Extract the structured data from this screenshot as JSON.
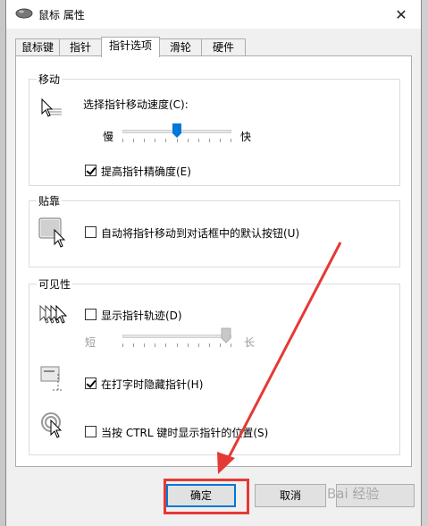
{
  "window": {
    "title": "鼠标 属性",
    "close_glyph": "✕"
  },
  "tabs": [
    {
      "label": "鼠标键",
      "active": false
    },
    {
      "label": "指针",
      "active": false
    },
    {
      "label": "指针选项",
      "active": true
    },
    {
      "label": "滑轮",
      "active": false
    },
    {
      "label": "硬件",
      "active": false
    }
  ],
  "motion": {
    "title": "移动",
    "speed_label": "选择指针移动速度(C):",
    "slow_label": "慢",
    "fast_label": "快",
    "speed_level": 0.5,
    "precision_label": "提高指针精确度(E)",
    "precision_checked": true
  },
  "snap": {
    "title": "贴靠",
    "snap_label": "自动将指针移动到对话框中的默认按钮(U)",
    "snap_checked": false
  },
  "visibility": {
    "title": "可见性",
    "trails_label": "显示指针轨迹(D)",
    "trails_checked": false,
    "short_label": "短",
    "long_label": "长",
    "trails_level": 1.0,
    "hide_label": "在打字时隐藏指针(H)",
    "hide_checked": true,
    "ctrl_label": "当按 CTRL 键时显示指针的位置(S)",
    "ctrl_checked": false
  },
  "buttons": {
    "ok": "确定",
    "cancel": "取消"
  },
  "watermark": "Bai 经验",
  "colors": {
    "accent": "#0078d7",
    "annotation": "#e53935"
  }
}
